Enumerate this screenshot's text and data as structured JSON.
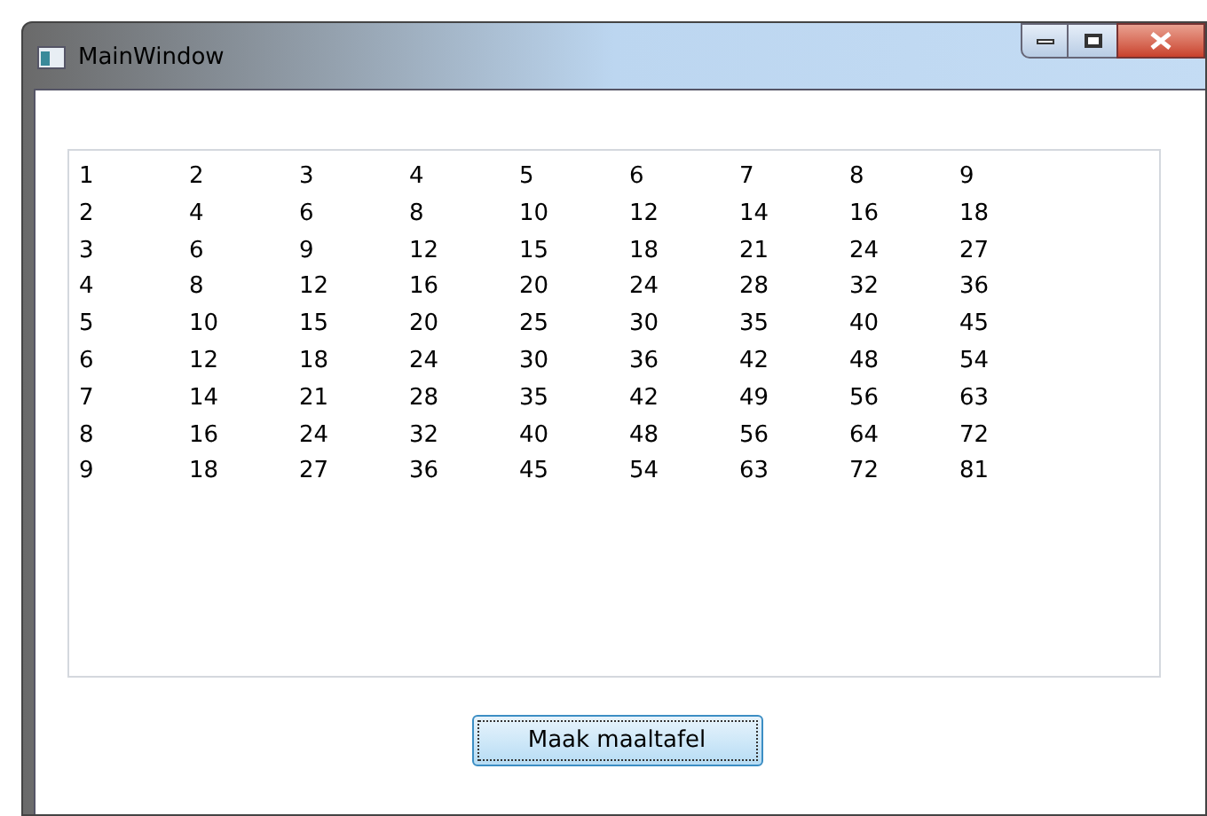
{
  "window": {
    "title": "MainWindow"
  },
  "list": {
    "rows": [
      [
        "1",
        "2",
        "3",
        "4",
        "5",
        "6",
        "7",
        "8",
        "9"
      ],
      [
        "2",
        "4",
        "6",
        "8",
        "10",
        "12",
        "14",
        "16",
        "18"
      ],
      [
        "3",
        "6",
        "9",
        "12",
        "15",
        "18",
        "21",
        "24",
        "27"
      ],
      [
        "4",
        "8",
        "12",
        "16",
        "20",
        "24",
        "28",
        "32",
        "36"
      ],
      [
        "5",
        "10",
        "15",
        "20",
        "25",
        "30",
        "35",
        "40",
        "45"
      ],
      [
        "6",
        "12",
        "18",
        "24",
        "30",
        "36",
        "42",
        "48",
        "54"
      ],
      [
        "7",
        "14",
        "21",
        "28",
        "35",
        "42",
        "49",
        "56",
        "63"
      ],
      [
        "8",
        "16",
        "24",
        "32",
        "40",
        "48",
        "56",
        "64",
        "72"
      ],
      [
        "9",
        "18",
        "27",
        "36",
        "45",
        "54",
        "63",
        "72",
        "81"
      ]
    ]
  },
  "button": {
    "label": "Maak maaltafel"
  }
}
